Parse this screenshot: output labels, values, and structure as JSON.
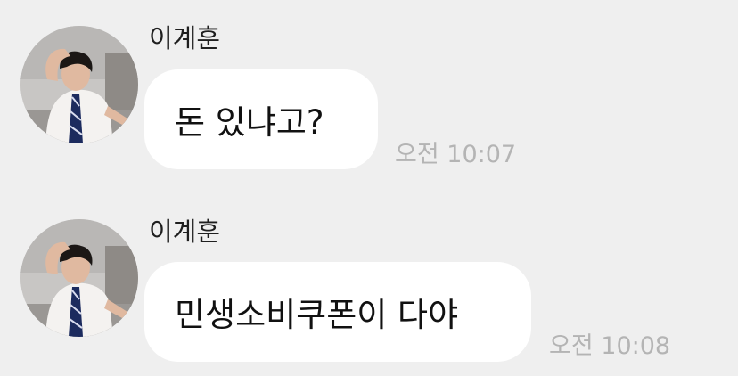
{
  "messages": [
    {
      "sender": "이계훈",
      "text": "돈 있냐고?",
      "time": "오전 10:07"
    },
    {
      "sender": "이계훈",
      "text": "민생소비쿠폰이 다야",
      "time": "오전 10:08"
    }
  ],
  "colors": {
    "background": "#efefef",
    "bubble": "#ffffff",
    "time_text": "#b4b4b4"
  }
}
